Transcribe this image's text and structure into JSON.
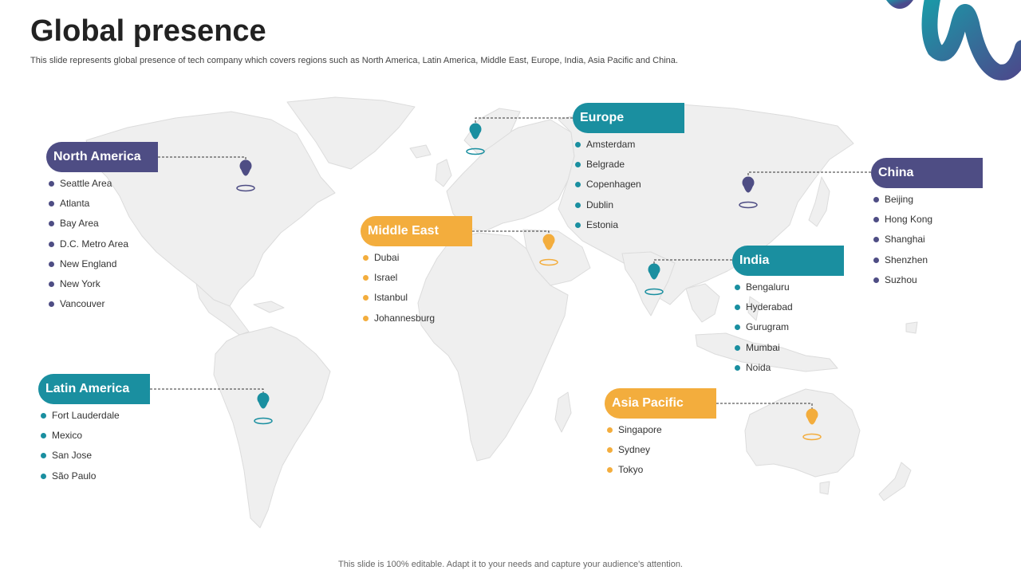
{
  "header": {
    "title": "Global presence",
    "subtitle": "This slide represents global presence of tech company which covers regions such as North America, Latin America, Middle East, Europe, India, Asia Pacific and China."
  },
  "footer": {
    "text": "This slide is 100% editable. Adapt it to your needs and capture your audience's attention."
  },
  "colors": {
    "navy": "#4e4d84",
    "teal": "#1a8fa0",
    "orange": "#f3ad3d",
    "land": "#efefef",
    "land_stroke": "#d9d9d9"
  },
  "regions": [
    {
      "name": "North America",
      "color": "navy",
      "cities": [
        "Seattle Area",
        "Atlanta",
        "Bay Area",
        "D.C. Metro Area",
        "New England",
        "New York",
        "Vancouver"
      ]
    },
    {
      "name": "Latin America",
      "color": "teal",
      "cities": [
        "Fort Lauderdale",
        "Mexico",
        "San Jose",
        "São Paulo"
      ]
    },
    {
      "name": "Middle East",
      "color": "orange",
      "cities": [
        "Dubai",
        "Israel",
        "Istanbul",
        "Johannesburg"
      ]
    },
    {
      "name": "Europe",
      "color": "teal",
      "cities": [
        "Amsterdam",
        "Belgrade",
        "Copenhagen",
        "Dublin",
        "Estonia"
      ]
    },
    {
      "name": "India",
      "color": "teal",
      "cities": [
        "Bengaluru",
        "Hyderabad",
        "Gurugram",
        "Mumbai",
        "Noida"
      ]
    },
    {
      "name": "Asia Pacific",
      "color": "orange",
      "cities": [
        "Singapore",
        "Sydney",
        "Tokyo"
      ]
    },
    {
      "name": "China",
      "color": "navy",
      "cities": [
        "Beijing",
        "Hong Kong",
        "Shanghai",
        "Shenzhen",
        "Suzhou"
      ]
    }
  ]
}
